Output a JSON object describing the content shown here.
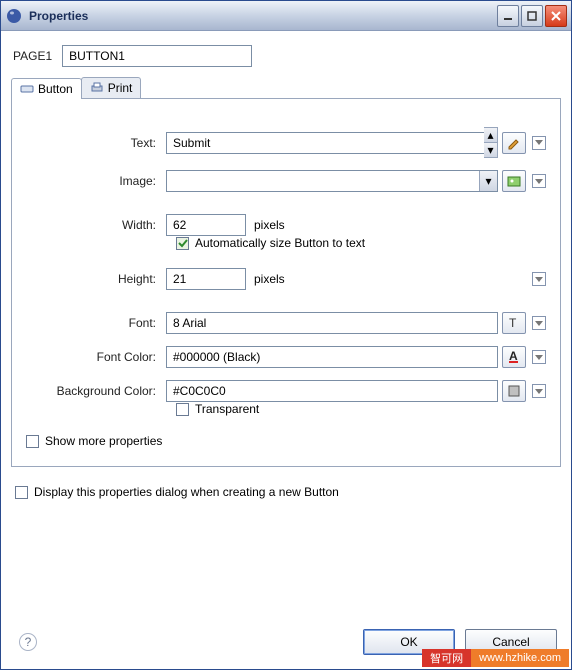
{
  "window": {
    "title": "Properties"
  },
  "header": {
    "page_label": "PAGE1",
    "id_value": "BUTTON1"
  },
  "tabs": {
    "button": "Button",
    "print": "Print"
  },
  "form": {
    "text_label": "Text:",
    "text_value": "Submit",
    "image_label": "Image:",
    "image_value": "",
    "width_label": "Width:",
    "width_value": "62",
    "pixels": "pixels",
    "autosize_label": "Automatically size Button to text",
    "autosize_checked": true,
    "height_label": "Height:",
    "height_value": "21",
    "font_label": "Font:",
    "font_value": "8 Arial",
    "fontcolor_label": "Font Color:",
    "fontcolor_value": "#000000 (Black)",
    "bgcolor_label": "Background Color:",
    "bgcolor_value": "#C0C0C0",
    "transparent_label": "Transparent",
    "showmore_label": "Show more properties"
  },
  "bottom": {
    "display_on_create": "Display this properties dialog when creating a new Button"
  },
  "footer": {
    "ok": "OK",
    "cancel": "Cancel"
  },
  "watermark": {
    "a": "智可网",
    "b": "www.hzhike.com"
  }
}
